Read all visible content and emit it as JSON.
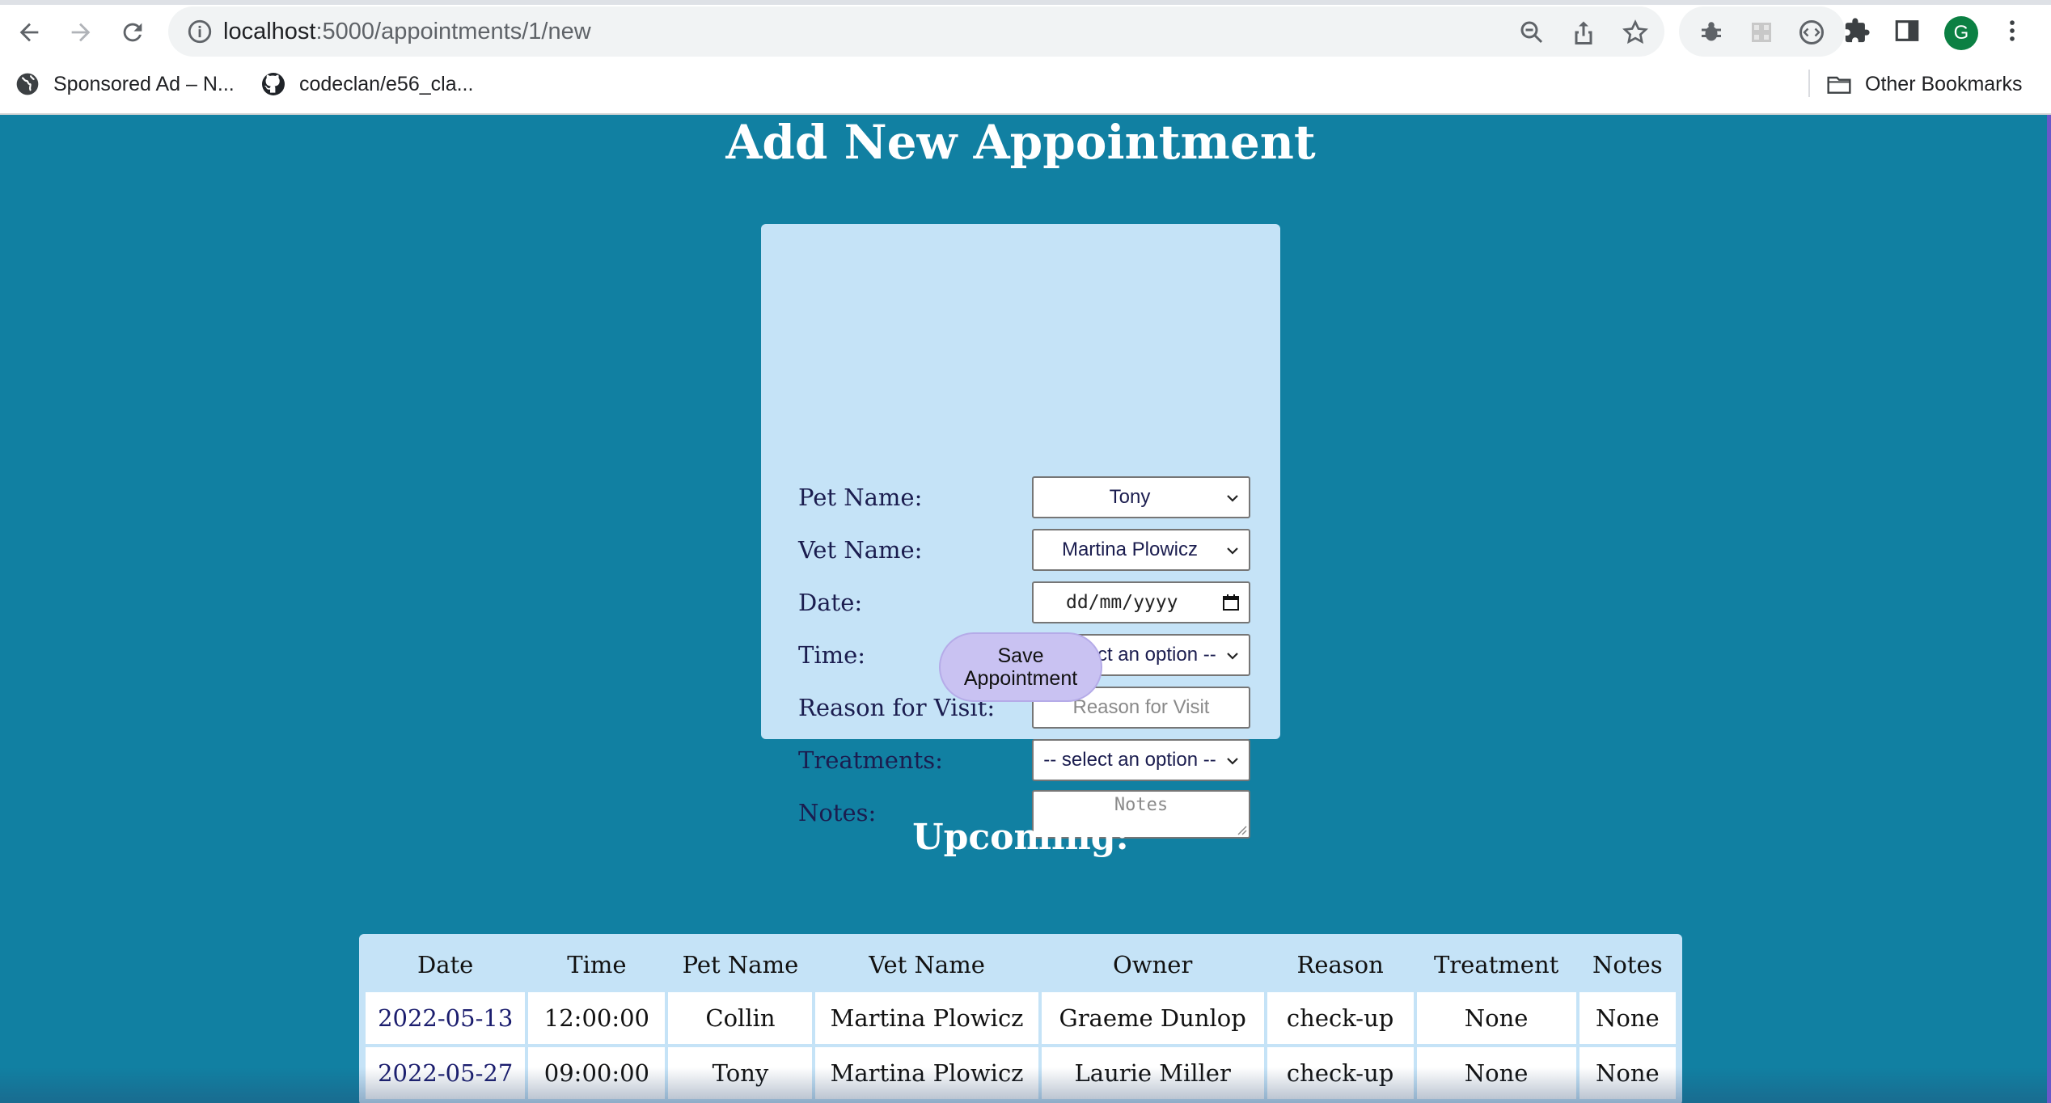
{
  "browser": {
    "url_host": "localhost",
    "url_path": ":5000/appointments/1/new",
    "avatar_letter": "G",
    "bookmarks": [
      {
        "label": "Sponsored Ad – N...",
        "icon": "globe-icon"
      },
      {
        "label": "codeclan/e56_cla...",
        "icon": "github-icon"
      }
    ],
    "other_bookmarks": "Other Bookmarks"
  },
  "page": {
    "title": "Add New Appointment",
    "form": {
      "pet_label": "Pet Name:",
      "pet_value": "Tony",
      "vet_label": "Vet Name:",
      "vet_value": "Martina Plowicz",
      "date_label": "Date:",
      "date_placeholder": "dd/mm/yyyy",
      "time_label": "Time:",
      "time_value": "-- select an option --",
      "reason_label": "Reason for Visit:",
      "reason_placeholder": "Reason for Visit",
      "treatments_label": "Treatments:",
      "treatments_value": "-- select an option --",
      "notes_label": "Notes:",
      "notes_placeholder": "Notes",
      "save_label": "Save Appointment"
    },
    "upcoming_title": "Upcoming:",
    "table": {
      "headers": [
        "Date",
        "Time",
        "Pet Name",
        "Vet Name",
        "Owner",
        "Reason",
        "Treatment",
        "Notes"
      ],
      "rows": [
        [
          "2022-05-13",
          "12:00:00",
          "Collin",
          "Martina Plowicz",
          "Graeme Dunlop",
          "check-up",
          "None",
          "None"
        ],
        [
          "2022-05-27",
          "09:00:00",
          "Tony",
          "Martina Plowicz",
          "Laurie Miller",
          "check-up",
          "None",
          "None"
        ]
      ]
    }
  },
  "colors": {
    "page_bg": "#1180a2",
    "card_bg": "#c5e3f7",
    "button_bg": "#c9c2f2",
    "label_text": "#1b1d4f"
  }
}
